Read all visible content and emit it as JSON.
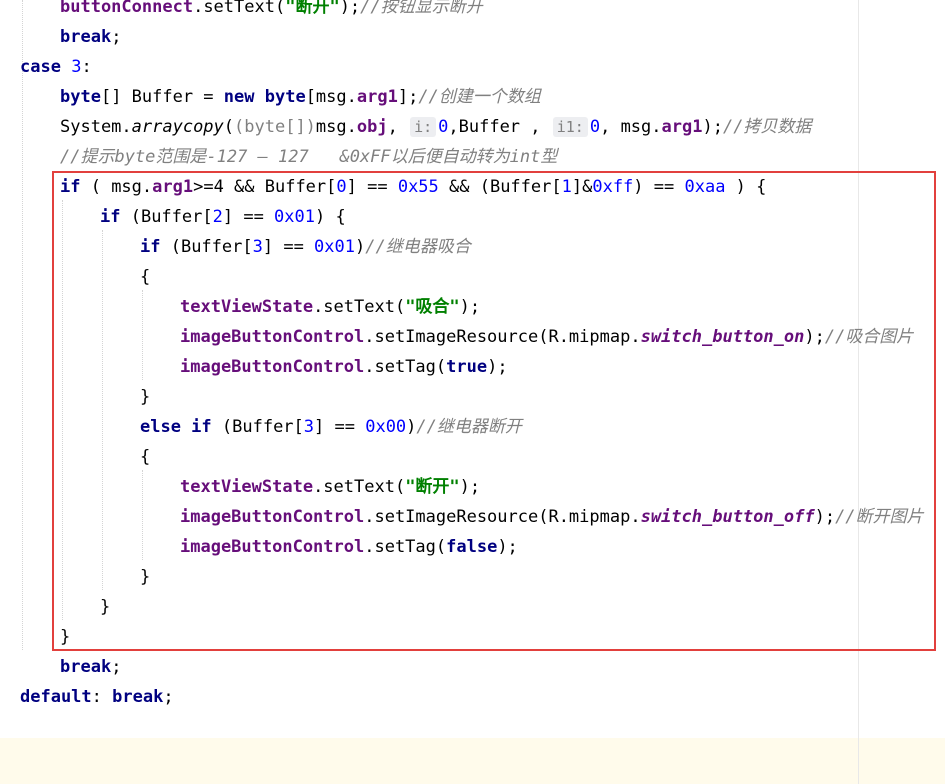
{
  "editor": {
    "lines": [
      {
        "indent": 60,
        "tokens": [
          [
            "fld",
            "buttonConnect"
          ],
          [
            "",
            "."
          ],
          [
            "",
            "setText("
          ],
          [
            "str",
            "\"断开\""
          ],
          [
            "",
            ");"
          ],
          [
            "cm",
            "//按钮显示断开"
          ]
        ]
      },
      {
        "indent": 60,
        "tokens": [
          [
            "kw",
            "break"
          ],
          [
            "",
            ";"
          ]
        ]
      },
      {
        "indent": 20,
        "tokens": [
          [
            "kw",
            "case "
          ],
          [
            "num",
            "3"
          ],
          [
            "",
            ":"
          ]
        ]
      },
      {
        "indent": 60,
        "tokens": [
          [
            "kw",
            "byte"
          ],
          [
            "",
            "[] Buffer = "
          ],
          [
            "kw",
            "new "
          ],
          [
            "kw",
            "byte"
          ],
          [
            "",
            "[msg."
          ],
          [
            "fld",
            "arg1"
          ],
          [
            "",
            "];"
          ],
          [
            "cm",
            "//创建一个数组"
          ]
        ]
      },
      {
        "indent": 60,
        "tokens": [
          [
            "",
            "System."
          ],
          [
            "sm",
            "arraycopy"
          ],
          [
            "",
            "("
          ],
          [
            "cast",
            "(byte[])"
          ],
          [
            "",
            "msg."
          ],
          [
            "fld",
            "obj"
          ],
          [
            "",
            ", "
          ],
          [
            "hint",
            "i:"
          ],
          [
            "num",
            "0"
          ],
          [
            "",
            ",Buffer , "
          ],
          [
            "hint",
            "i1:"
          ],
          [
            "num",
            "0"
          ],
          [
            "",
            ", msg."
          ],
          [
            "fld",
            "arg1"
          ],
          [
            "",
            ");"
          ],
          [
            "cm",
            "//拷贝数据"
          ]
        ]
      },
      {
        "indent": 60,
        "tokens": [
          [
            "cm",
            "//提示byte范围是-127 — 127   &0xFF以后便自动转为int型"
          ]
        ]
      },
      {
        "indent": 60,
        "tokens": [
          [
            "kw",
            "if "
          ],
          [
            "",
            "( msg."
          ],
          [
            "fld",
            "arg1"
          ],
          [
            "",
            ">=4 && Buffer["
          ],
          [
            "num",
            "0"
          ],
          [
            "",
            "] == "
          ],
          [
            "num",
            "0x55"
          ],
          [
            "",
            " && (Buffer["
          ],
          [
            "num",
            "1"
          ],
          [
            "",
            "]&"
          ],
          [
            "num",
            "0xff"
          ],
          [
            "",
            ") == "
          ],
          [
            "num",
            "0xaa"
          ],
          [
            "",
            " ) {"
          ]
        ]
      },
      {
        "indent": 100,
        "tokens": [
          [
            "kw",
            "if "
          ],
          [
            "",
            "(Buffer["
          ],
          [
            "num",
            "2"
          ],
          [
            "",
            "] == "
          ],
          [
            "num",
            "0x01"
          ],
          [
            "",
            ") {"
          ]
        ]
      },
      {
        "indent": 140,
        "tokens": [
          [
            "kw",
            "if "
          ],
          [
            "",
            "(Buffer["
          ],
          [
            "num",
            "3"
          ],
          [
            "",
            "] == "
          ],
          [
            "num",
            "0x01"
          ],
          [
            "",
            ")"
          ],
          [
            "cm",
            "//继电器吸合"
          ]
        ]
      },
      {
        "indent": 140,
        "tokens": [
          [
            "",
            "{"
          ]
        ]
      },
      {
        "indent": 180,
        "tokens": [
          [
            "fld",
            "textViewState"
          ],
          [
            "",
            ".setText("
          ],
          [
            "str",
            "\"吸合\""
          ],
          [
            "",
            ");"
          ]
        ]
      },
      {
        "indent": 180,
        "tokens": [
          [
            "fld",
            "imageButtonControl"
          ],
          [
            "",
            ".setImageResource(R.mipmap."
          ],
          [
            "sfld",
            "switch_button_on"
          ],
          [
            "",
            ");"
          ],
          [
            "cm",
            "//吸合图片"
          ]
        ]
      },
      {
        "indent": 180,
        "tokens": [
          [
            "fld",
            "imageButtonControl"
          ],
          [
            "",
            ".setTag("
          ],
          [
            "kw",
            "true"
          ],
          [
            "",
            ");"
          ]
        ]
      },
      {
        "indent": 140,
        "tokens": [
          [
            "",
            "}"
          ]
        ]
      },
      {
        "indent": 140,
        "tokens": [
          [
            "kw",
            "else if "
          ],
          [
            "",
            "(Buffer["
          ],
          [
            "num",
            "3"
          ],
          [
            "",
            "] == "
          ],
          [
            "num",
            "0x00"
          ],
          [
            "",
            ")"
          ],
          [
            "cm",
            "//继电器断开"
          ]
        ]
      },
      {
        "indent": 140,
        "tokens": [
          [
            "",
            "{"
          ]
        ]
      },
      {
        "indent": 180,
        "tokens": [
          [
            "fld",
            "textViewState"
          ],
          [
            "",
            ".setText("
          ],
          [
            "str",
            "\"断开\""
          ],
          [
            "",
            ");"
          ]
        ]
      },
      {
        "indent": 180,
        "tokens": [
          [
            "fld",
            "imageButtonControl"
          ],
          [
            "",
            ".setImageResource(R.mipmap."
          ],
          [
            "sfld",
            "switch_button_off"
          ],
          [
            "",
            ");"
          ],
          [
            "cm",
            "//断开图片"
          ]
        ]
      },
      {
        "indent": 180,
        "tokens": [
          [
            "fld",
            "imageButtonControl"
          ],
          [
            "",
            ".setTag("
          ],
          [
            "kw",
            "false"
          ],
          [
            "",
            ");"
          ]
        ]
      },
      {
        "indent": 140,
        "tokens": [
          [
            "",
            "}"
          ]
        ]
      },
      {
        "indent": 100,
        "tokens": [
          [
            "",
            "}"
          ]
        ]
      },
      {
        "indent": 60,
        "tokens": [
          [
            "",
            "}"
          ]
        ]
      },
      {
        "indent": 60,
        "tokens": [
          [
            "kw",
            "break"
          ],
          [
            "",
            ";"
          ]
        ]
      },
      {
        "indent": 20,
        "tokens": [
          [
            "kw",
            "default"
          ],
          [
            "",
            ": "
          ],
          [
            "kw",
            "break"
          ],
          [
            "",
            ";"
          ]
        ]
      }
    ]
  }
}
